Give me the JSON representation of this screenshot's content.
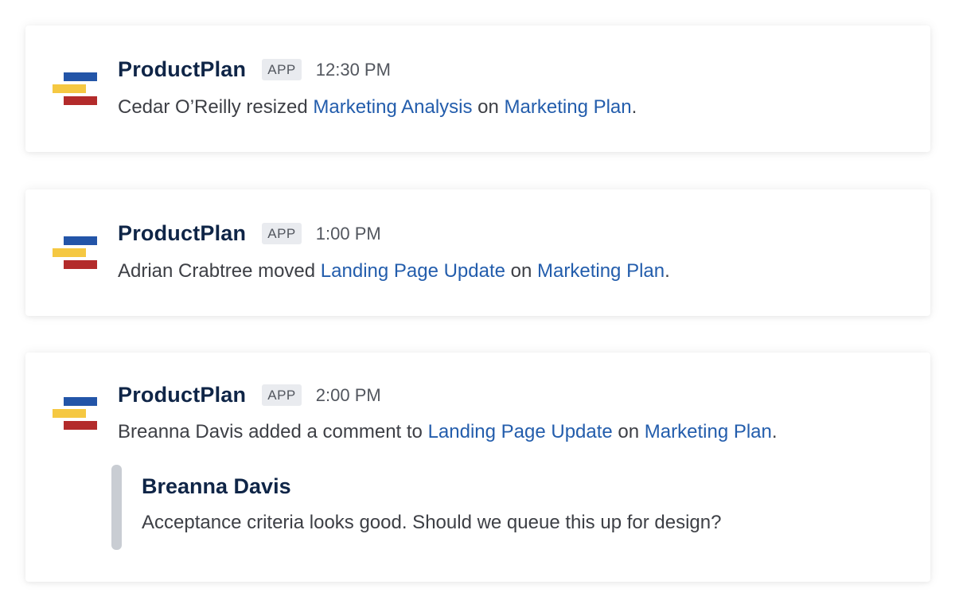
{
  "brand_colors": {
    "blue": "#2355a8",
    "yellow": "#f5c842",
    "red": "#b32b2b",
    "link": "#235dac"
  },
  "notifications": [
    {
      "app_name": "ProductPlan",
      "badge": "APP",
      "time": "12:30 PM",
      "message": {
        "actor": "Cedar O’Reilly resized ",
        "item": "Marketing Analysis",
        "connector": " on ",
        "plan": "Marketing Plan",
        "end": "."
      }
    },
    {
      "app_name": "ProductPlan",
      "badge": "APP",
      "time": "1:00 PM",
      "message": {
        "actor": "Adrian Crabtree moved ",
        "item": "Landing Page Update",
        "connector": " on ",
        "plan": "Marketing Plan",
        "end": "."
      }
    },
    {
      "app_name": "ProductPlan",
      "badge": "APP",
      "time": "2:00 PM",
      "message": {
        "actor": "Breanna Davis added a comment to ",
        "item": "Landing Page Update",
        "connector": " on ",
        "plan": "Marketing Plan",
        "end": "."
      },
      "comment": {
        "author": "Breanna Davis",
        "text": "Acceptance criteria looks good. Should we queue this up for design?"
      }
    }
  ]
}
